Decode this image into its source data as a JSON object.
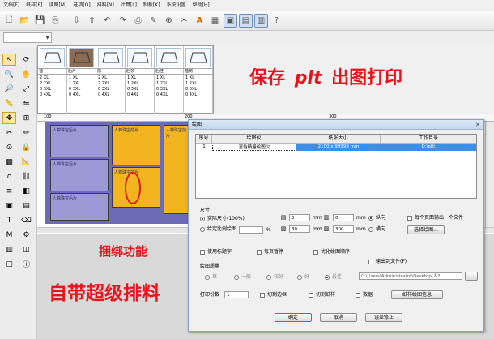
{
  "menu": [
    "文档[F]",
    "纸样[P]",
    "读图[M]",
    "选项[O]",
    "排料[N]",
    "计算[L]",
    "制板[K]",
    "系统设置",
    "帮助[H]"
  ],
  "toolbar_icons": [
    "new-icon",
    "open-icon",
    "save-icon",
    "copy-icon",
    "import-icon",
    "export-icon",
    "undo-icon",
    "redo-icon",
    "print-icon",
    "plot-icon",
    "zoom-icon",
    "tool-icon",
    "text-icon",
    "chart-icon",
    "view-icon",
    "grid-icon",
    "layout-icon"
  ],
  "pieces": [
    {
      "header": "袖",
      "rows": [
        "2 XL",
        "2 2XL",
        "0 3XL",
        "0 4XL"
      ]
    },
    {
      "header": "后片",
      "rows": [
        "1 XL",
        "1 2XL",
        "0 3XL",
        "0 4XL"
      ]
    },
    {
      "header": "前",
      "rows": [
        "2 XL",
        "2 2XL",
        "0 3XL",
        "0 4XL"
      ]
    },
    {
      "header": "后领",
      "rows": [
        "1 XL",
        "1 2XL",
        "0 3XL",
        "0 4XL"
      ]
    },
    {
      "header": "后挂",
      "rows": [
        "1 XL",
        "1 2XL",
        "0 3XL",
        "0 4XL"
      ]
    },
    {
      "header": "袖侧",
      "rows": [
        "1 XL",
        "1 2XL",
        "0 3XL",
        "0 4XL"
      ]
    }
  ],
  "piece_header_sizes": [
    "2XL 2XL",
    "3XL",
    "3XL 3XL",
    "4XL"
  ],
  "ruler": [
    "100",
    "200",
    "300"
  ],
  "ad": {
    "top_line1": "保存",
    "top_plt": "plt",
    "top_line2": "出图打印",
    "mid": "捆绑功能",
    "bottom": "自带超级排料"
  },
  "piece_labels": [
    "人棉珠宝后片",
    "人棉珠宝前片",
    "人棉珠宝后片",
    "人棉珠宝前片",
    "人棉珠宝后片",
    "人棉珠宝前片"
  ],
  "dialog": {
    "title": "绘图",
    "columns": [
      "序号",
      "绘图仪",
      "纸张大小",
      "工作目录"
    ],
    "row": {
      "index": "1",
      "plotter": "富怡精量绘图仪",
      "paper": "2100 x 99999 mm",
      "dir": "D:\\plt\\"
    },
    "size_label": "尺寸",
    "radio_actual": "实际尺寸(100%)",
    "radio_ratio": "给定比例绘图",
    "ratio_unit": "%",
    "margin_top": "0",
    "margin_right": "0",
    "margin_left": "30",
    "margin_bottom": "300",
    "unit_mm": "mm",
    "orient_portrait": "纵向",
    "orient_landscape": "横向",
    "output_each_page": "每个页面输出一个文件",
    "select_plotter": "选择绘图...",
    "chk_use_notes": "使用标题字",
    "chk_pause_page": "每页暂停",
    "chk_optimize": "优化绘图顺序",
    "chk_output_file": "输出到文件(F)",
    "path": "C:\\Users\\Administrator\\Desktop\\人2",
    "path_btn": "...",
    "quality_label": "绘图质量",
    "q_options": [
      "草",
      "一般",
      "较好",
      "好",
      "最佳"
    ],
    "copies_label": "打印份数",
    "copies": "1",
    "chk_cut_line": "切割边框",
    "chk_cut_paper": "切割纸样",
    "chk_blank": "数据",
    "btn_info": "纸样绘图信息",
    "btn_ok": "确定",
    "btn_cancel": "取消",
    "btn_correct": "误差修正"
  },
  "colors": {
    "accent": "#3d8ee6",
    "ad_red": "#e8141c",
    "piece_orange": "#f2b41f",
    "piece_purple": "#9c9ad6"
  }
}
